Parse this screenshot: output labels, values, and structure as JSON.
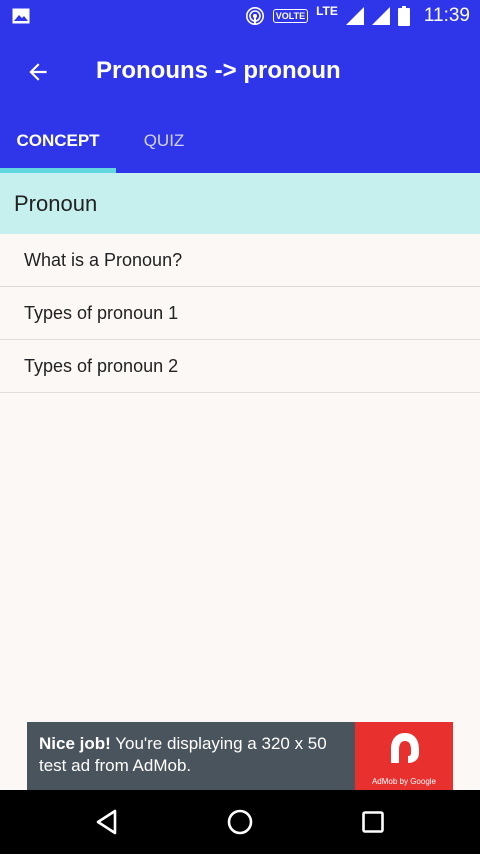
{
  "status_bar": {
    "volte": "VOLTE",
    "network": "LTE",
    "time": "11:39",
    "icons": [
      "image-icon",
      "hotspot-icon",
      "signal-icon",
      "signal-icon",
      "battery-icon"
    ]
  },
  "app_bar": {
    "title": "Pronouns -> pronoun",
    "back_icon": "arrow-left-icon"
  },
  "tabs": [
    {
      "label": "CONCEPT",
      "selected": true
    },
    {
      "label": "QUIZ",
      "selected": false
    }
  ],
  "section": {
    "title": "Pronoun"
  },
  "list": {
    "items": [
      {
        "label": "What is a Pronoun?"
      },
      {
        "label": "Types of pronoun 1"
      },
      {
        "label": "Types of pronoun 2"
      }
    ]
  },
  "ad": {
    "headline": "Nice job!",
    "body": " You're displaying a 320 x 50 test ad from AdMob.",
    "caption": "AdMob by Google"
  },
  "colors": {
    "primary": "#2f35e8",
    "section_bg": "#c6f0ed",
    "tab_indicator": "#62d7e0",
    "ad_bg": "#4a545c",
    "ad_logo": "#e8312f"
  }
}
